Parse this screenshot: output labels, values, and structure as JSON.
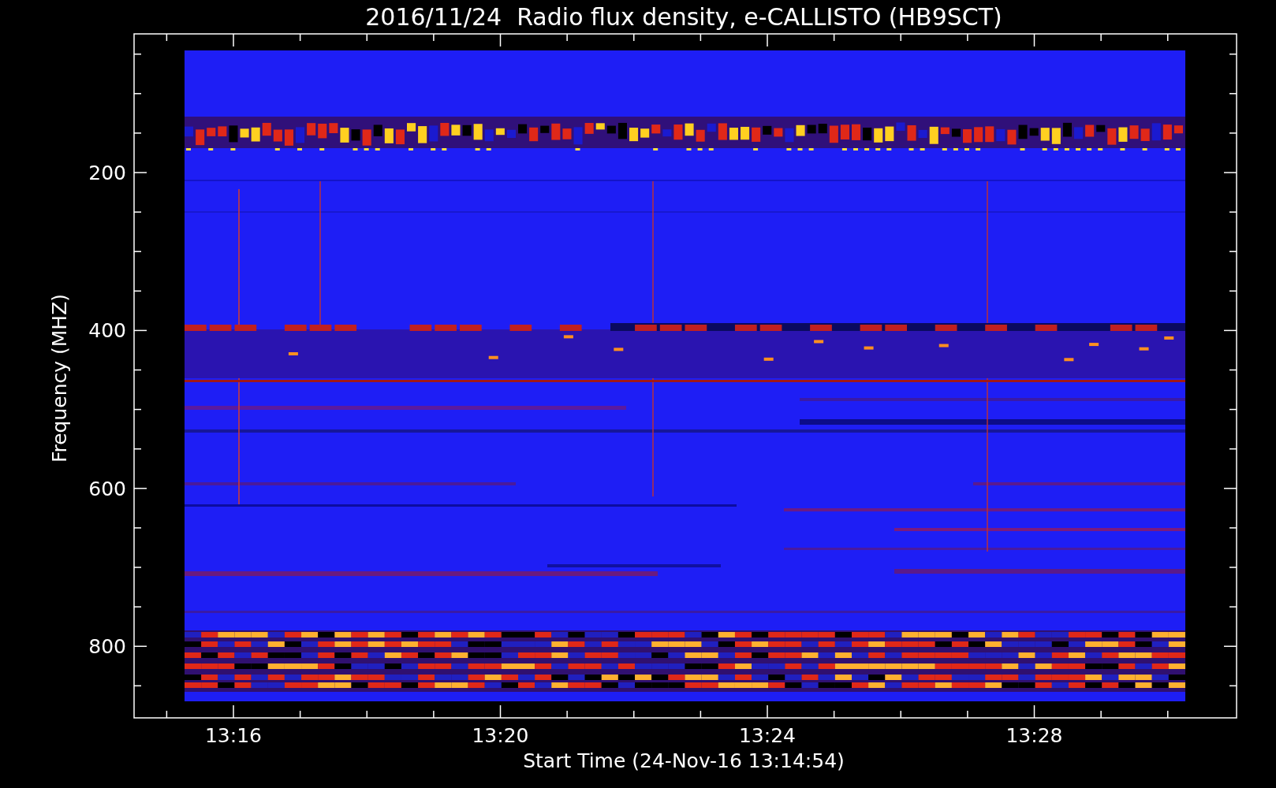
{
  "title": "2016/11/24  Radio flux density, e-CALLISTO (HB9SCT)",
  "y_axis": {
    "label": "Frequency (MHZ)",
    "ticks": [
      "200",
      "400",
      "600",
      "800"
    ]
  },
  "x_axis": {
    "label": "Start Time (24-Nov-16 13:14:54)",
    "ticks": [
      "13:16",
      "13:20",
      "13:24",
      "13:28"
    ]
  }
}
